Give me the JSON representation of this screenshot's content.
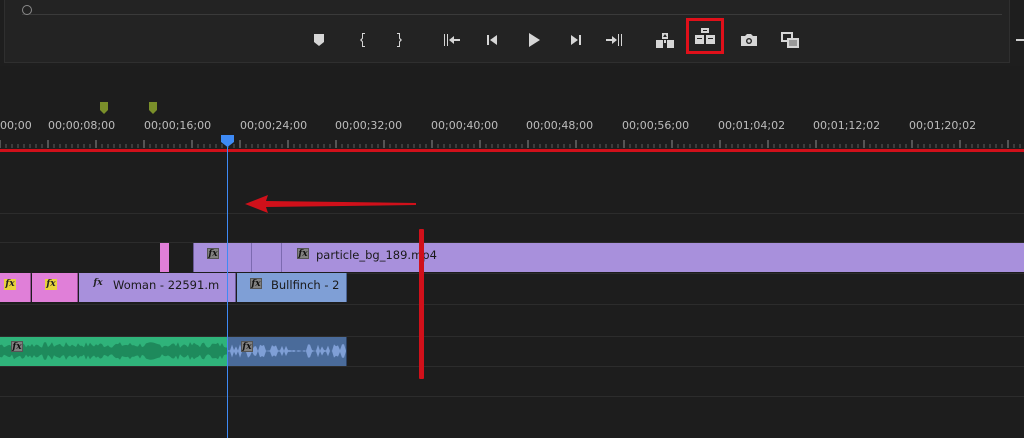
{
  "monitor": {
    "buttons": [
      {
        "name": "add-marker",
        "icon": "marker-icon"
      },
      {
        "name": "mark-in",
        "icon": "mark-in-icon"
      },
      {
        "name": "mark-out",
        "icon": "mark-out-icon"
      },
      {
        "name": "go-to-in",
        "icon": "go-to-in-icon"
      },
      {
        "name": "step-back",
        "icon": "step-back-icon"
      },
      {
        "name": "play",
        "icon": "play-icon"
      },
      {
        "name": "step-forward",
        "icon": "step-forward-icon"
      },
      {
        "name": "go-to-out",
        "icon": "go-to-out-icon"
      },
      {
        "name": "lift",
        "icon": "lift-icon"
      },
      {
        "name": "extract",
        "icon": "extract-icon",
        "highlighted": true
      },
      {
        "name": "export-frame",
        "icon": "camera-icon"
      },
      {
        "name": "comparison-view",
        "icon": "comparison-view-icon"
      }
    ],
    "highlight_color": "#e0101a"
  },
  "timeline": {
    "timecodes": [
      "00;00",
      "00;00;08;00",
      "00;00;16;00",
      "00;00;24;00",
      "00;00;32;00",
      "00;00;40;00",
      "00;00;48;00",
      "00;00;56;00",
      "00;01;04;02",
      "00;01;12;02",
      "00;01;20;02"
    ],
    "marker_color": "#7a8f2a",
    "work_area_color": "#d0101a",
    "playhead_color": "#3e8af5",
    "clips": {
      "particle": {
        "label": "particle_bg_189.mp4",
        "color": "#a890dc"
      },
      "woman": {
        "label": "Woman - 22591.m",
        "color": "#a890dc"
      },
      "bullfinch": {
        "label": "Bullfinch - 2",
        "color": "#7f9fd6"
      },
      "pink": {
        "color": "#e07fd8"
      },
      "audio_green": {
        "color": "#2fb37a"
      },
      "audio_blue": {
        "color": "#4a6b9a"
      }
    },
    "fx_label": "fx"
  },
  "annotations": {
    "arrow": "left-arrow",
    "bar": "vertical-bar",
    "color": "#d0101a"
  }
}
